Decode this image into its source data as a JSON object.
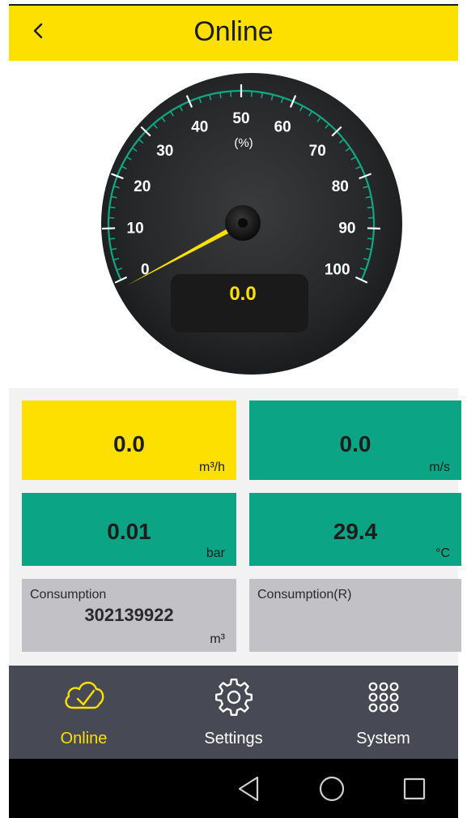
{
  "header": {
    "title": "Online",
    "back_icon": "chevron-left-icon"
  },
  "gauge": {
    "unit_label": "(%)",
    "ticks": [
      "0",
      "10",
      "20",
      "30",
      "40",
      "50",
      "60",
      "70",
      "80",
      "90",
      "100"
    ],
    "readout": "0.0",
    "needle_value": 0,
    "accent": "#fde000",
    "arc_color": "#12a783"
  },
  "tiles": {
    "flow": {
      "value": "0.0",
      "unit": "m³/h"
    },
    "velocity": {
      "value": "0.0",
      "unit": "m/s"
    },
    "pressure": {
      "value": "0.01",
      "unit": "bar"
    },
    "temperature": {
      "value": "29.4",
      "unit": "°C"
    },
    "consumption": {
      "label": "Consumption",
      "value": "302139922",
      "unit": "m³"
    },
    "consumption_r": {
      "label": "Consumption(R)"
    }
  },
  "nav": {
    "items": [
      {
        "label": "Online",
        "icon": "cloud-check-icon",
        "active": true
      },
      {
        "label": "Settings",
        "icon": "gear-icon",
        "active": false
      },
      {
        "label": "System",
        "icon": "grid-dots-icon",
        "active": false
      }
    ]
  },
  "system_bar": {
    "icons": [
      "back-triangle-icon",
      "home-circle-icon",
      "recents-square-icon"
    ]
  },
  "colors": {
    "yellow": "#fde000",
    "green": "#0ba585",
    "grey": "#c2c2c6",
    "nav": "#474a55"
  }
}
